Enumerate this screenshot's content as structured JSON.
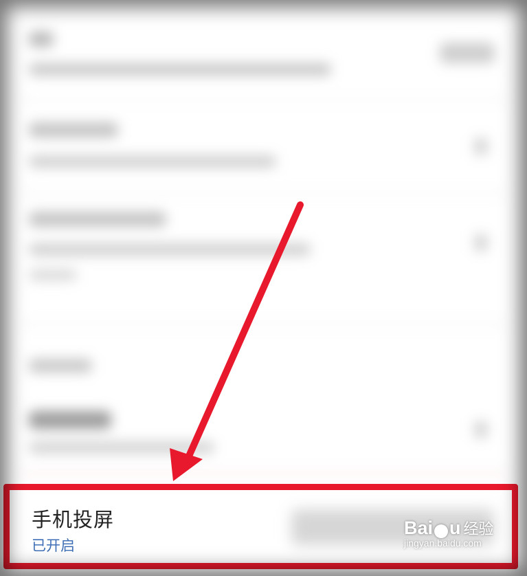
{
  "settings_row": {
    "title": "手机投屏",
    "status": "已开启"
  },
  "annotation": {
    "arrow_color": "#e8192c",
    "box_color": "#e8192c"
  },
  "watermark": {
    "logo_pre": "Bai",
    "logo_post": "u",
    "name": "经验",
    "url": "jingyan.baidu.com"
  },
  "colors": {
    "status_text": "#3f6fb6",
    "title_text": "#222222"
  }
}
